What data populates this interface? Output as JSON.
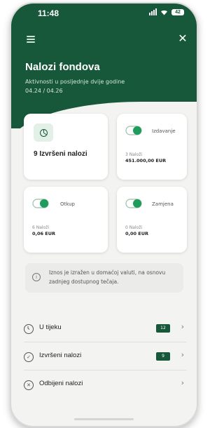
{
  "status_bar": {
    "time": "11:48",
    "battery": "42"
  },
  "header": {
    "title": "Nalozi fondova",
    "subtitle": "Aktivnosti u posljednje dvije godine",
    "date_range": "04.24 / 04.26"
  },
  "cards": {
    "executed": {
      "label": "9 Izvršeni nalozi"
    },
    "issue": {
      "type": "Izdavanje",
      "count": "3 Naloži",
      "amount": "451.000,00 EUR"
    },
    "redeem": {
      "type": "Otkup",
      "count": "6 Naloži",
      "amount": "0,06 EUR"
    },
    "exchange": {
      "type": "Zamjena",
      "count": "0 Naloži",
      "amount": "0,00 EUR"
    }
  },
  "info": {
    "text": "Iznos je izražen u domaćoj valuti, na osnovu zadnjeg dostupnog tečaja."
  },
  "list": {
    "in_progress": {
      "label": "U tijeku",
      "badge": "12"
    },
    "executed": {
      "label": "Izvršeni nalozi",
      "badge": "9"
    },
    "rejected": {
      "label": "Odbijeni nalozi"
    }
  },
  "colors": {
    "brand_green": "#17573a",
    "background": "#f3f3f1"
  },
  "icons": {
    "menu": "menu-icon",
    "close": "close-icon",
    "clock": "clock-icon",
    "check": "check-circle-icon",
    "reject": "x-circle-icon",
    "info": "info-icon",
    "chevron": "chevron-right-icon"
  }
}
